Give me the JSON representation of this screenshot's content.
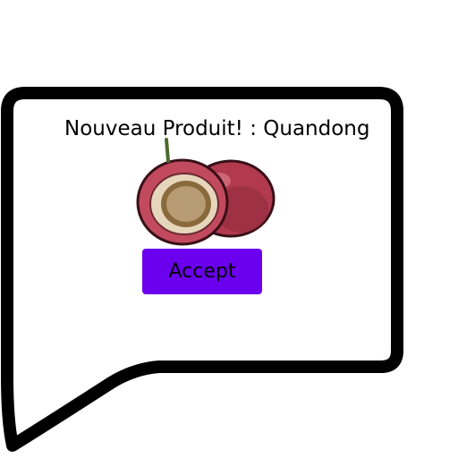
{
  "dialog": {
    "header_label": "Nouveau Produit!",
    "separator": " : ",
    "product_name": "Quandong",
    "accept_label": "Accept"
  },
  "icons": {
    "product_image": "quandong-fruit-icon"
  },
  "colors": {
    "accept_button": "#6a00ee",
    "bubble_border": "#000000",
    "fruit_skin": "#b23a4e",
    "fruit_flesh": "#e6d6bc",
    "fruit_seed": "#8a6a3c"
  }
}
